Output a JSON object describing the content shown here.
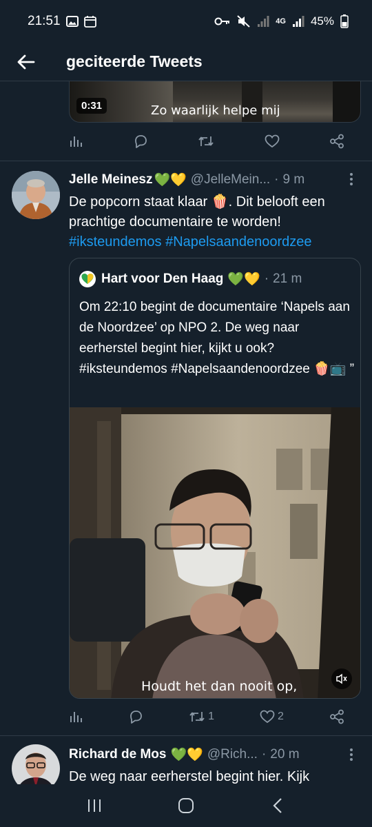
{
  "status_bar": {
    "time": "21:51",
    "network": "4G",
    "battery": "45%",
    "icons": [
      "image-icon",
      "calendar-icon",
      "key-icon",
      "mute-icon",
      "signal-icon",
      "battery-icon"
    ]
  },
  "header": {
    "title": "geciteerde Tweets",
    "back_icon": "arrow-left-icon"
  },
  "tweet1": {
    "video_duration": "0:31",
    "video_subtitle": "Zo waarlijk helpe mij"
  },
  "tweet2": {
    "name": "Jelle Meinesz",
    "name_emoji": "💚💛",
    "handle": "@JelleMein...",
    "separator": "·",
    "time": "9 m",
    "text": "De popcorn staat klaar 🍿. Dit belooft een prachtige documentaire te worden!",
    "hashtags": [
      "#iksteundemos",
      "#Napelsaandenoordzee"
    ],
    "quote": {
      "name": "Hart voor Den Haag",
      "name_emoji": "💚💛",
      "separator": "·",
      "time": "21 m",
      "text": "Om 22:10 begint de documentaire ‘Napels aan de Noordzee’ op NPO 2. De weg naar eerherstel begint hier, kijkt u ook? #iksteundemos #Napelsaandenoordzee 🍿📺 ”",
      "video_subtitle": "Houdt het dan nooit op,"
    },
    "retweet_count": "1",
    "like_count": "2"
  },
  "tweet3": {
    "name": "Richard de Mos",
    "name_emoji": "💚💛",
    "handle": "@Rich...",
    "separator": "·",
    "time": "20 m",
    "text": "De weg naar eerherstel begint hier. Kijk"
  },
  "colors": {
    "background": "#15202b",
    "accent": "#1d9bf0",
    "muted": "#8b98a5",
    "border": "#2f3b47"
  }
}
